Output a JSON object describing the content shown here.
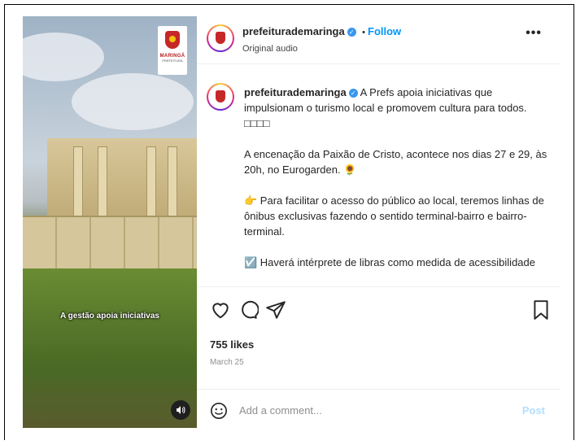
{
  "media": {
    "caption_overlay": "A gestão apoia iniciativas",
    "logo_text": "MARINGÁ",
    "logo_sub": "PREFEITURA",
    "audio_icon": "speaker-icon"
  },
  "header": {
    "username": "prefeiturademaringa",
    "separator": "•",
    "follow_label": "Follow",
    "subtitle": "Original audio",
    "more_label": "•••"
  },
  "caption": {
    "username": "prefeiturademaringa",
    "text_1": "A Prefs apoia iniciativas que impulsionam o turismo local e promovem cultura para todos.",
    "boxes": "□□□□",
    "paragraph_2": "A encenação da Paixão de Cristo, acontece nos dias 27 e 29, às 20h, no Eurogarden. 🌻",
    "paragraph_3": "👉 Para facilitar o acesso do público ao local, teremos linhas de ônibus exclusivas fazendo o sentido terminal-bairro e bairro-terminal.",
    "paragraph_4": "☑️ Haverá intérprete de libras como medida de acessibilidade"
  },
  "engagement": {
    "likes": "755 likes",
    "date": "March 25"
  },
  "comment_box": {
    "placeholder": "Add a comment...",
    "post_label": "Post"
  },
  "colors": {
    "accent": "#0095f6",
    "verified": "#3897f0",
    "post_disabled": "#b2dffc"
  }
}
